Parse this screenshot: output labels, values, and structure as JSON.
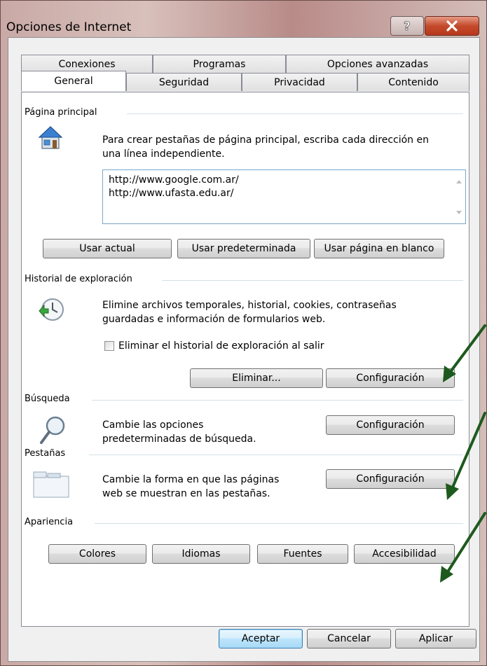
{
  "window": {
    "title": "Opciones de Internet"
  },
  "tabs": {
    "row1": [
      "Conexiones",
      "Programas",
      "Opciones avanzadas"
    ],
    "row2": [
      "General",
      "Seguridad",
      "Privacidad",
      "Contenido"
    ],
    "active": "General"
  },
  "home": {
    "group_label": "Página principal",
    "description_line1": "Para crear pestañas de página principal, escriba cada dirección en",
    "description_line2": "una línea independiente.",
    "urls": [
      "http://www.google.com.ar/",
      "http://www.ufasta.edu.ar/"
    ],
    "btn_current": "Usar actual",
    "btn_default": "Usar predeterminada",
    "btn_blank": "Usar página en blanco"
  },
  "history": {
    "group_label": "Historial de exploración",
    "description_line1": "Elimine archivos temporales, historial, cookies, contraseñas",
    "description_line2": "guardadas e información de formularios web.",
    "checkbox_label": "Eliminar el historial de exploración al salir",
    "btn_delete": "Eliminar...",
    "btn_settings": "Configuración"
  },
  "search": {
    "group_label": "Búsqueda",
    "description_line1": "Cambie las opciones",
    "description_line2": "predeterminadas de búsqueda.",
    "btn_settings": "Configuración"
  },
  "tabs_section": {
    "group_label": "Pestañas",
    "description_line1": "Cambie la forma en que las páginas",
    "description_line2": "web se muestran en las pestañas.",
    "btn_settings": "Configuración"
  },
  "appearance": {
    "group_label": "Apariencia",
    "btn_colors": "Colores",
    "btn_languages": "Idiomas",
    "btn_fonts": "Fuentes",
    "btn_accessibility": "Accesibilidad"
  },
  "footer": {
    "btn_ok": "Aceptar",
    "btn_cancel": "Cancelar",
    "btn_apply": "Aplicar"
  },
  "colors": {
    "annotation_arrow": "#1e5a1e",
    "close_button": "#c44a2c"
  }
}
